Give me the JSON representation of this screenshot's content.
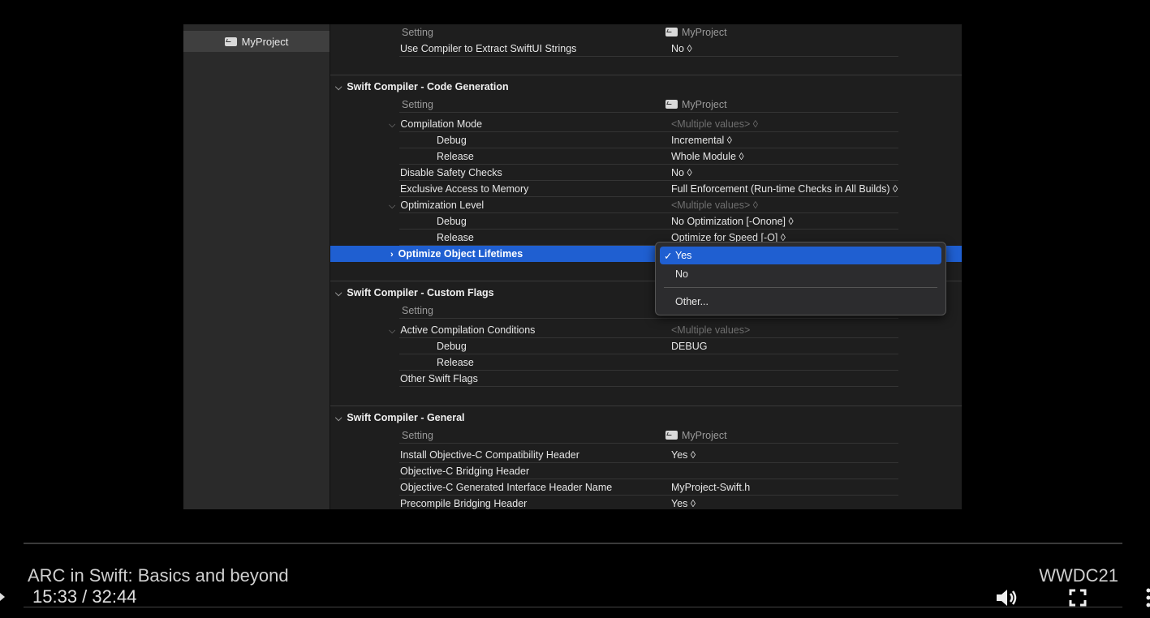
{
  "sidebar": {
    "target_label": "MyProject"
  },
  "top_rows": {
    "setting_header": "Setting",
    "project_col": "MyProject",
    "swiftui_strings": {
      "label": "Use Compiler to Extract SwiftUI Strings",
      "value": "No ◊"
    }
  },
  "codegen": {
    "title": "Swift Compiler - Code Generation",
    "setting_header": "Setting",
    "project_col": "MyProject",
    "compilation_mode": {
      "label": "Compilation Mode",
      "value": "<Multiple values> ◊"
    },
    "cm_debug": {
      "label": "Debug",
      "value": "Incremental ◊"
    },
    "cm_release": {
      "label": "Release",
      "value": "Whole Module ◊"
    },
    "disable_safety": {
      "label": "Disable Safety Checks",
      "value": "No ◊"
    },
    "exclusive_access": {
      "label": "Exclusive Access to Memory",
      "value": "Full Enforcement (Run-time Checks in All Builds) ◊"
    },
    "opt_level": {
      "label": "Optimization Level",
      "value": "<Multiple values> ◊"
    },
    "ol_debug": {
      "label": "Debug",
      "value": "No Optimization [-Onone] ◊"
    },
    "ol_release": {
      "label": "Release",
      "value": "Optimize for Speed [-O] ◊"
    },
    "opt_lifetimes": {
      "label": "Optimize Object Lifetimes"
    }
  },
  "popup": {
    "check": "✓",
    "opt_yes": "Yes",
    "opt_no": "No",
    "opt_other": "Other..."
  },
  "custom_flags": {
    "title": "Swift Compiler - Custom Flags",
    "setting_header": "Setting",
    "active_conditions": {
      "label": "Active Compilation Conditions",
      "value": "<Multiple values>"
    },
    "ac_debug": {
      "label": "Debug",
      "value": "DEBUG"
    },
    "ac_release": {
      "label": "Release"
    },
    "other_flags": {
      "label": "Other Swift Flags"
    }
  },
  "general": {
    "title": "Swift Compiler - General",
    "setting_header": "Setting",
    "project_col": "MyProject",
    "install_header": {
      "label": "Install Objective-C Compatibility Header",
      "value": "Yes ◊"
    },
    "bridging_header": {
      "label": "Objective-C Bridging Header"
    },
    "generated_header": {
      "label": "Objective-C Generated Interface Header Name",
      "value": "MyProject-Swift.h"
    },
    "precompile": {
      "label": "Precompile Bridging Header",
      "value": "Yes ◊"
    }
  },
  "player": {
    "title": "ARC in Swift: Basics and beyond",
    "time": "15:33 / 32:44",
    "brand": "WWDC21"
  },
  "icons": {
    "chevron_down": "⌵",
    "chevron_right": "›",
    "play": "play-icon",
    "volume": "speaker-icon",
    "fullscreen": "fullscreen-icon",
    "more": "more-icon",
    "target": "target-icon"
  }
}
